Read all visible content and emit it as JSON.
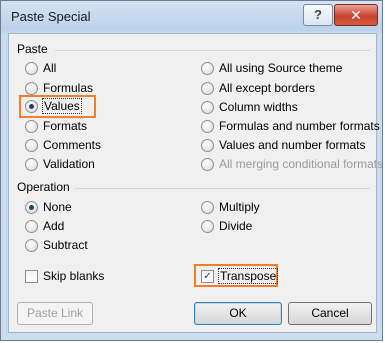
{
  "dialog": {
    "title": "Paste Special",
    "help_label": "?",
    "close_label": "✕"
  },
  "paste": {
    "label": "Paste",
    "left_options": [
      "All",
      "Formulas",
      "Values",
      "Formats",
      "Comments",
      "Validation"
    ],
    "right_options": [
      "All using Source theme",
      "All except borders",
      "Column widths",
      "Formulas and number formats",
      "Values and number formats",
      "All merging conditional formats"
    ],
    "selected": "Values",
    "disabled": [
      "All merging conditional formats"
    ]
  },
  "operation": {
    "label": "Operation",
    "left_options": [
      "None",
      "Add",
      "Subtract"
    ],
    "right_options": [
      "Multiply",
      "Divide"
    ],
    "selected": "None"
  },
  "checkboxes": {
    "skip_blanks": {
      "label": "Skip blanks",
      "checked": false
    },
    "transpose": {
      "label": "Transpose",
      "checked": true
    }
  },
  "buttons": {
    "paste_link": "Paste Link",
    "ok": "OK",
    "cancel": "Cancel"
  },
  "highlight_color": "#ef7e2d"
}
